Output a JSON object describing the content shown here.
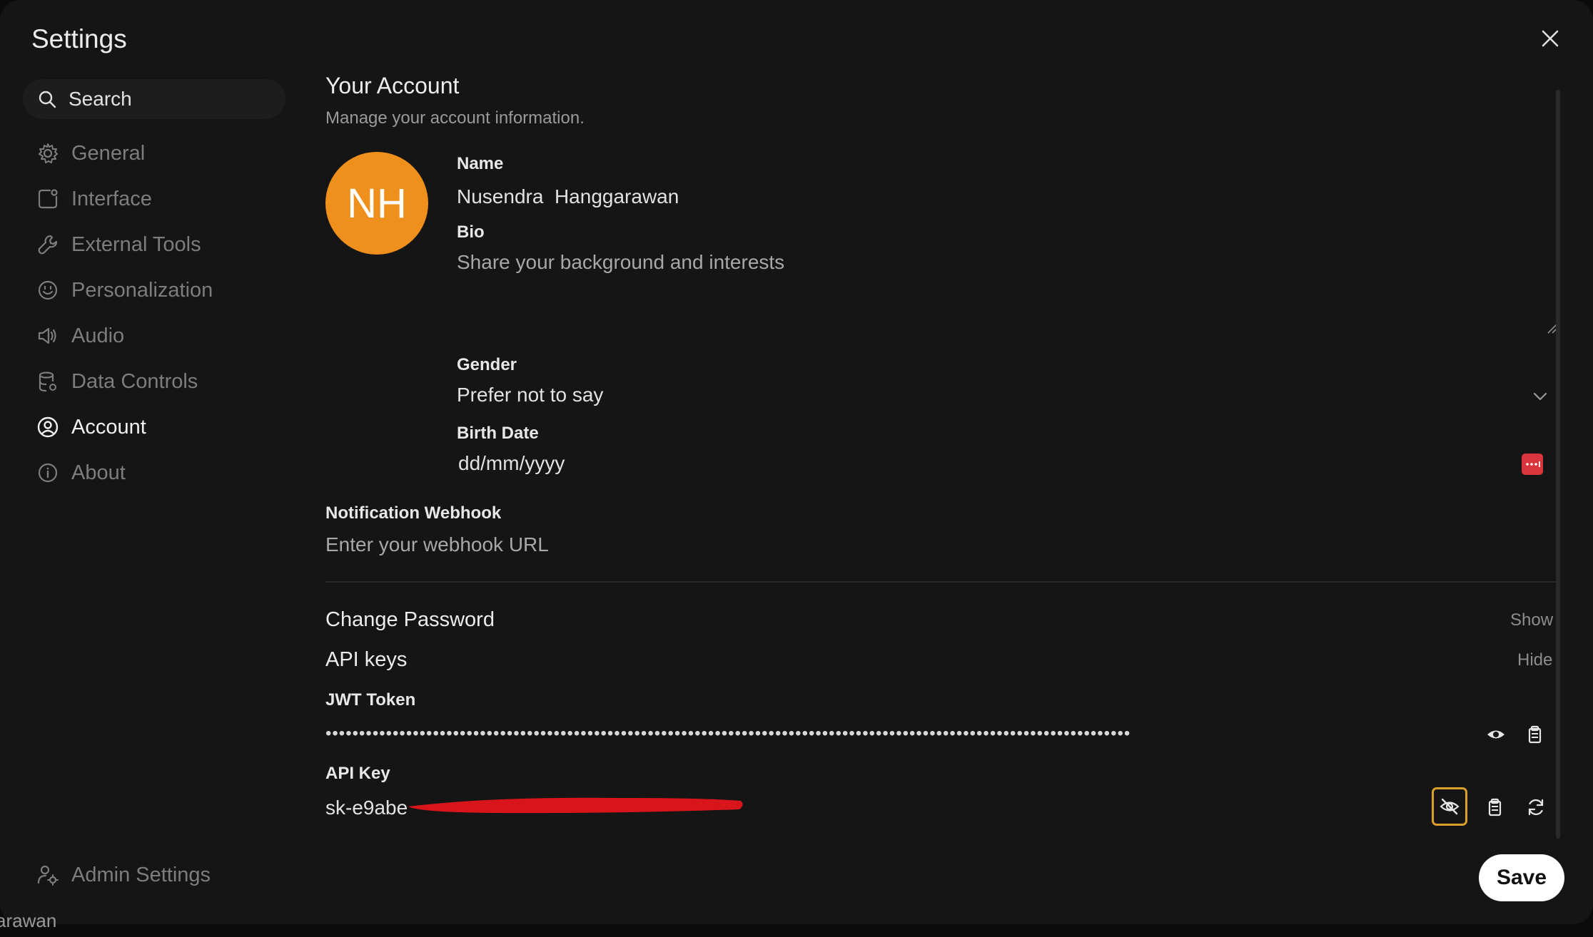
{
  "window": {
    "title": "Settings"
  },
  "search": {
    "placeholder": "Search"
  },
  "sidebar": {
    "items": [
      {
        "label": "General",
        "icon": "gear-icon"
      },
      {
        "label": "Interface",
        "icon": "interface-icon"
      },
      {
        "label": "External Tools",
        "icon": "wrench-icon"
      },
      {
        "label": "Personalization",
        "icon": "smile-icon"
      },
      {
        "label": "Audio",
        "icon": "speaker-icon"
      },
      {
        "label": "Data Controls",
        "icon": "database-icon"
      },
      {
        "label": "Account",
        "icon": "user-circle-icon",
        "active": true
      },
      {
        "label": "About",
        "icon": "info-icon"
      }
    ],
    "admin": {
      "label": "Admin Settings",
      "icon": "user-cog-icon"
    }
  },
  "account": {
    "title": "Your Account",
    "subtitle": "Manage your account information.",
    "avatar_initials": "NH",
    "avatar_color": "#f0901c",
    "name_label": "Name",
    "name_value": "Nusendra  Hanggarawan",
    "bio_label": "Bio",
    "bio_placeholder": "Share your background and interests",
    "gender_label": "Gender",
    "gender_value": "Prefer not to say",
    "birth_label": "Birth Date",
    "birth_placeholder": "dd/mm/yyyy",
    "webhook_label": "Notification Webhook",
    "webhook_placeholder": "Enter your webhook URL"
  },
  "password": {
    "title": "Change Password",
    "toggle": "Show"
  },
  "api": {
    "title": "API keys",
    "toggle": "Hide",
    "jwt_label": "JWT Token",
    "jwt_masked": "••••••••••••••••••••••••••••••••••••••••••••••••••••••••••••••••••••••••••••••••••••••••••••••••••••••••••••••••••••••••",
    "key_label": "API Key",
    "key_value": "sk-e9abe"
  },
  "actions": {
    "save": "Save"
  },
  "background": {
    "partial_text": "arawan"
  },
  "colors": {
    "accent_focus": "#d9a02b",
    "calendar": "#d8353c",
    "redaction": "#d8151b"
  }
}
